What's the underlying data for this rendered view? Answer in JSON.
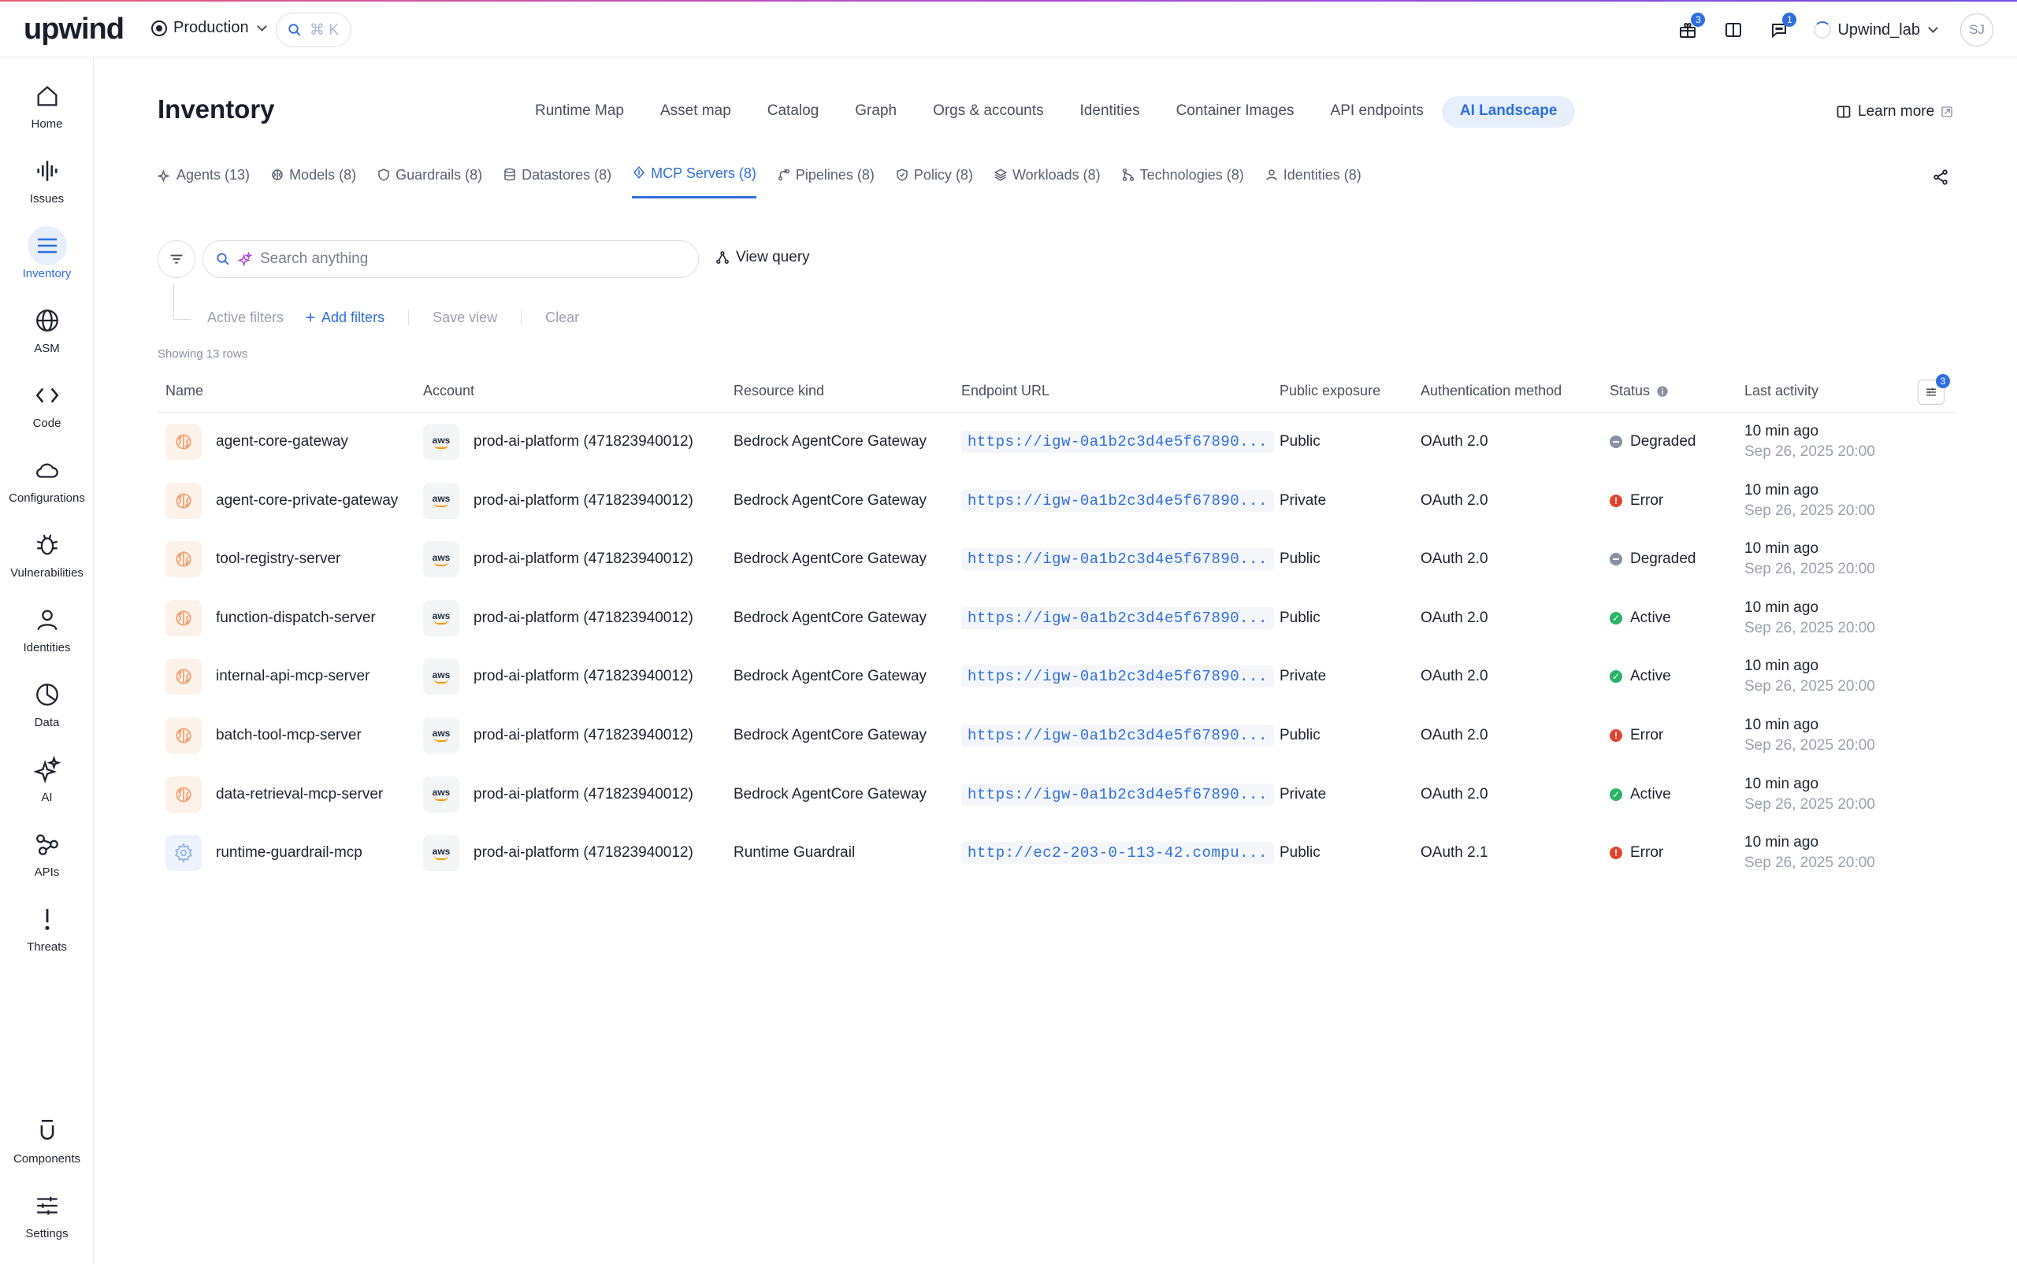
{
  "topbar": {
    "logo": "upwind",
    "environment": "Production",
    "search_shortcut": "⌘ K",
    "gift_badge": "3",
    "chat_badge": "1",
    "org_name": "Upwind_lab",
    "avatar_initials": "SJ"
  },
  "sidebar": {
    "items": [
      {
        "label": "Home",
        "icon": "home-icon"
      },
      {
        "label": "Issues",
        "icon": "issues-icon"
      },
      {
        "label": "Inventory",
        "icon": "inventory-icon"
      },
      {
        "label": "ASM",
        "icon": "globe-icon"
      },
      {
        "label": "Code",
        "icon": "code-icon"
      },
      {
        "label": "Configurations",
        "icon": "cloud-icon"
      },
      {
        "label": "Vulnerabilities",
        "icon": "bug-icon"
      },
      {
        "label": "Identities",
        "icon": "person-icon"
      },
      {
        "label": "Data",
        "icon": "pie-icon"
      },
      {
        "label": "AI",
        "icon": "sparkle-icon"
      },
      {
        "label": "APIs",
        "icon": "share-nodes-icon"
      },
      {
        "label": "Threats",
        "icon": "exclamation-icon"
      },
      {
        "label": "Components",
        "icon": "components-icon"
      },
      {
        "label": "Settings",
        "icon": "sliders-icon"
      }
    ],
    "active": "Inventory"
  },
  "header": {
    "title": "Inventory",
    "tabs": [
      "Runtime Map",
      "Asset map",
      "Catalog",
      "Graph",
      "Orgs & accounts",
      "Identities",
      "Container Images",
      "API endpoints",
      "AI Landscape"
    ],
    "active_tab": "AI Landscape",
    "learn_more": "Learn more"
  },
  "subtabs": [
    {
      "label": "Agents (13)",
      "icon": "sparkle-icon"
    },
    {
      "label": "Models (8)",
      "icon": "brain-icon"
    },
    {
      "label": "Guardrails (8)",
      "icon": "shield-icon"
    },
    {
      "label": "Datastores (8)",
      "icon": "database-icon"
    },
    {
      "label": "MCP Servers (8)",
      "icon": "mcp-icon"
    },
    {
      "label": "Pipelines (8)",
      "icon": "pipeline-icon"
    },
    {
      "label": "Policy (8)",
      "icon": "shield-check-icon"
    },
    {
      "label": "Workloads (8)",
      "icon": "layers-icon"
    },
    {
      "label": "Technologies (8)",
      "icon": "branch-icon"
    },
    {
      "label": "Identities (8)",
      "icon": "person-icon"
    }
  ],
  "active_subtab": "MCP Servers (8)",
  "filters": {
    "search_placeholder": "Search anything",
    "view_query": "View query",
    "active_filters": "Active filters",
    "add_filters": "Add filters",
    "save_view": "Save view",
    "clear": "Clear",
    "showing": "Showing 13 rows"
  },
  "table": {
    "columns": [
      "Name",
      "Account",
      "Resource kind",
      "Endpoint URL",
      "Public exposure",
      "Authentication method",
      "Status",
      "Last activity"
    ],
    "column_settings_badge": "3",
    "rows": [
      {
        "name": "agent-core-gateway",
        "icon": "brain",
        "account": "prod-ai-platform (471823940012)",
        "resource_kind": "Bedrock AgentCore Gateway",
        "endpoint": "https://igw-0a1b2c3d4e5f67890...",
        "exposure": "Public",
        "auth": "OAuth 2.0",
        "status": "Degraded",
        "last1": "10 min ago",
        "last2": "Sep 26, 2025 20:00"
      },
      {
        "name": "agent-core-private-gateway",
        "icon": "brain",
        "account": "prod-ai-platform (471823940012)",
        "resource_kind": "Bedrock AgentCore Gateway",
        "endpoint": "https://igw-0a1b2c3d4e5f67890...",
        "exposure": "Private",
        "auth": "OAuth 2.0",
        "status": "Error",
        "last1": "10 min ago",
        "last2": "Sep 26, 2025 20:00"
      },
      {
        "name": "tool-registry-server",
        "icon": "brain",
        "account": "prod-ai-platform (471823940012)",
        "resource_kind": "Bedrock AgentCore Gateway",
        "endpoint": "https://igw-0a1b2c3d4e5f67890...",
        "exposure": "Public",
        "auth": "OAuth 2.0",
        "status": "Degraded",
        "last1": "10 min ago",
        "last2": "Sep 26, 2025 20:00"
      },
      {
        "name": "function-dispatch-server",
        "icon": "brain",
        "account": "prod-ai-platform (471823940012)",
        "resource_kind": "Bedrock AgentCore Gateway",
        "endpoint": "https://igw-0a1b2c3d4e5f67890...",
        "exposure": "Public",
        "auth": "OAuth 2.0",
        "status": "Active",
        "last1": "10 min ago",
        "last2": "Sep 26, 2025 20:00"
      },
      {
        "name": "internal-api-mcp-server",
        "icon": "brain",
        "account": "prod-ai-platform (471823940012)",
        "resource_kind": "Bedrock AgentCore Gateway",
        "endpoint": "https://igw-0a1b2c3d4e5f67890...",
        "exposure": "Private",
        "auth": "OAuth 2.0",
        "status": "Active",
        "last1": "10 min ago",
        "last2": "Sep 26, 2025 20:00"
      },
      {
        "name": "batch-tool-mcp-server",
        "icon": "brain",
        "account": "prod-ai-platform (471823940012)",
        "resource_kind": "Bedrock AgentCore Gateway",
        "endpoint": "https://igw-0a1b2c3d4e5f67890...",
        "exposure": "Public",
        "auth": "OAuth 2.0",
        "status": "Error",
        "last1": "10 min ago",
        "last2": "Sep 26, 2025 20:00"
      },
      {
        "name": "data-retrieval-mcp-server",
        "icon": "brain",
        "account": "prod-ai-platform (471823940012)",
        "resource_kind": "Bedrock AgentCore Gateway",
        "endpoint": "https://igw-0a1b2c3d4e5f67890...",
        "exposure": "Private",
        "auth": "OAuth 2.0",
        "status": "Active",
        "last1": "10 min ago",
        "last2": "Sep 26, 2025 20:00"
      },
      {
        "name": "runtime-guardrail-mcp",
        "icon": "gear",
        "account": "prod-ai-platform (471823940012)",
        "resource_kind": "Runtime Guardrail",
        "endpoint": "http://ec2-203-0-113-42.compu...",
        "exposure": "Public",
        "auth": "OAuth 2.1",
        "status": "Error",
        "last1": "10 min ago",
        "last2": "Sep 26, 2025 20:00"
      }
    ]
  },
  "colors": {
    "accent": "#2f6fdd",
    "active_status": "#2bb36b",
    "error_status": "#e0442f",
    "degraded_status": "#8a90a0",
    "brain_icon": "#f0a070"
  }
}
